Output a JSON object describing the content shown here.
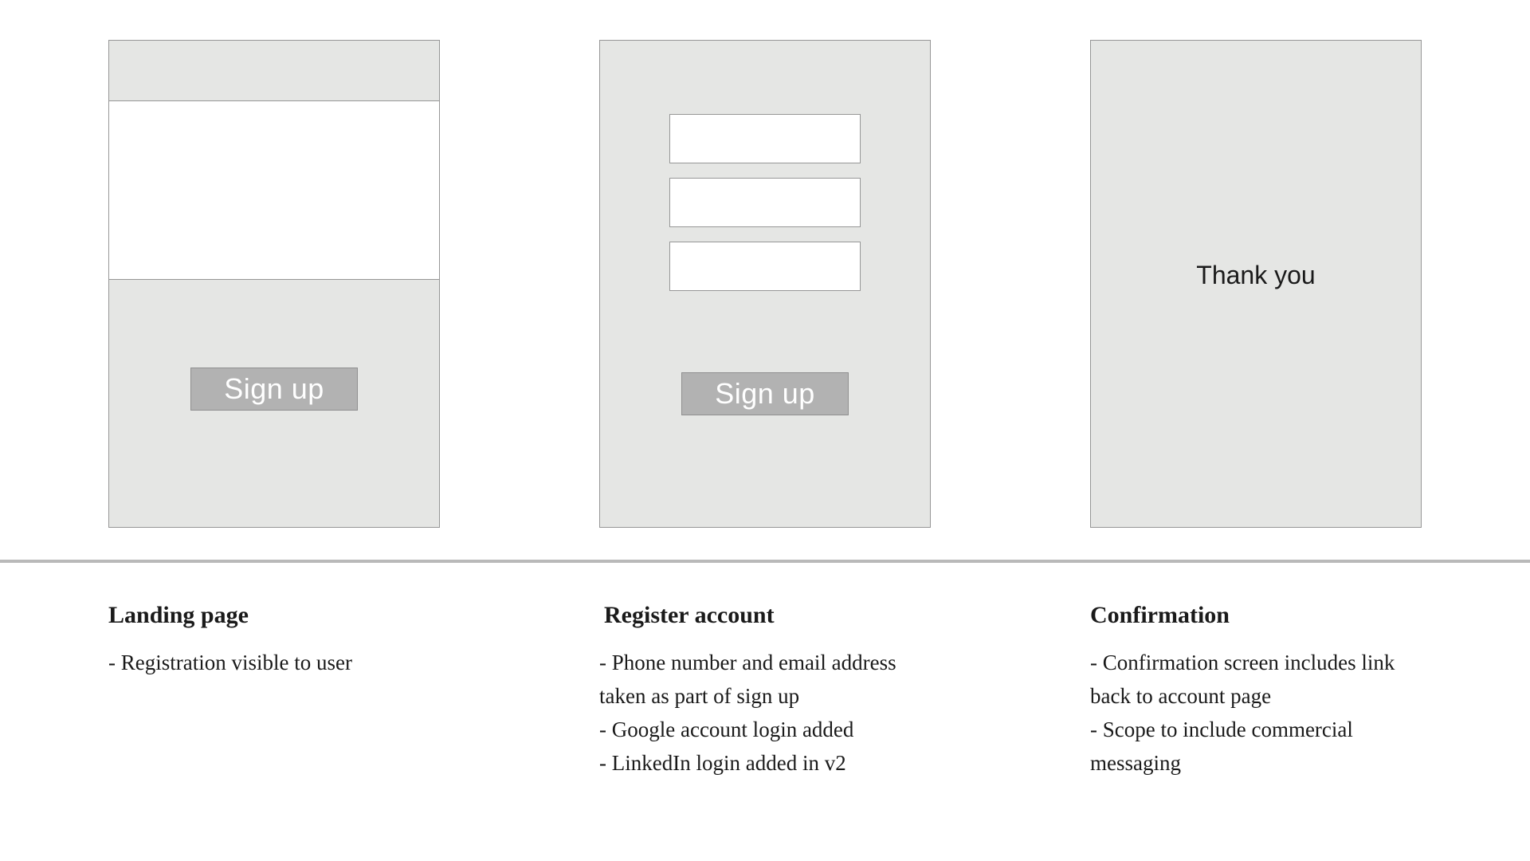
{
  "screens": {
    "landing": {
      "signup_label": "Sign up"
    },
    "register": {
      "signup_label": "Sign up"
    },
    "confirmation": {
      "message": "Thank you"
    }
  },
  "captions": {
    "landing": {
      "title": "Landing page",
      "items": [
        "Registration visible to user"
      ]
    },
    "register": {
      "title": "Register account",
      "items": [
        "Phone number and email address taken as part of sign up",
        "Google account login added",
        "LinkedIn login added in v2"
      ]
    },
    "confirmation": {
      "title": "Confirmation",
      "items": [
        "Confirmation screen includes link back to account page",
        "Scope to include commercial messaging"
      ]
    }
  }
}
